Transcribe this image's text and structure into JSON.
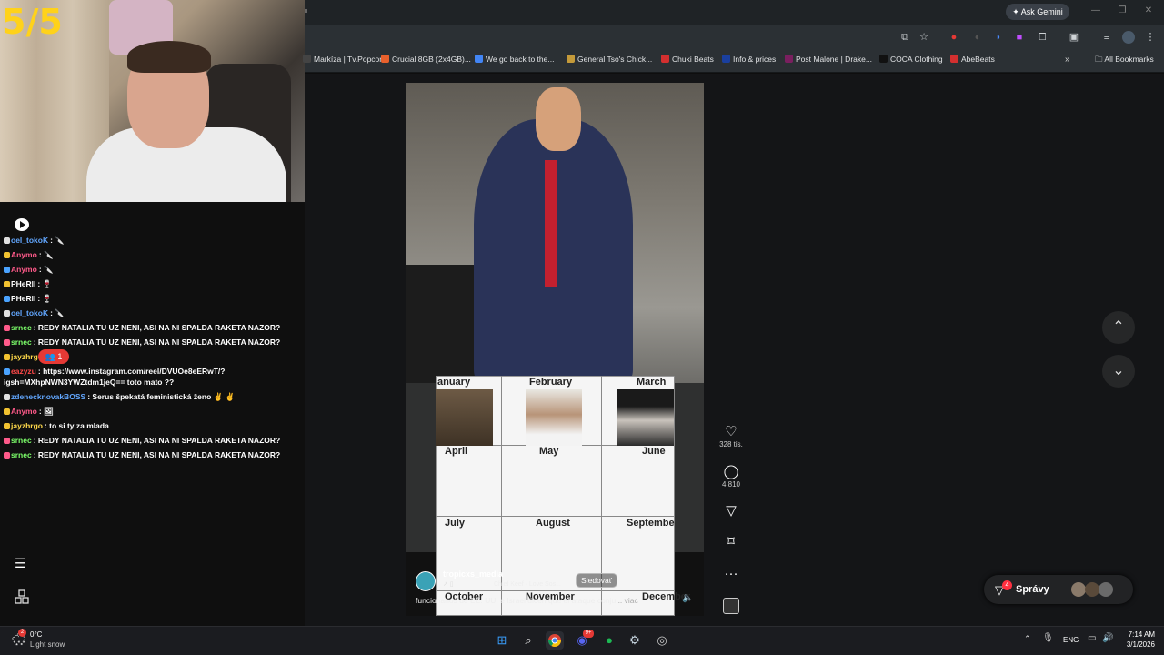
{
  "stream": {
    "score": "5/5",
    "chat": [
      {
        "user": "oel_tokoK",
        "user_color": "#62a7ff",
        "msg": ": 🔪"
      },
      {
        "user": "Anymo",
        "user_color": "#ff5a8a",
        "msg": ": 🔪"
      },
      {
        "user": "Anymo",
        "user_color": "#ff5a8a",
        "msg": ": 🔪"
      },
      {
        "user": "PHeRll",
        "user_color": "#ffffff",
        "msg": ": 🍷"
      },
      {
        "user": "PHeRll",
        "user_color": "#ffffff",
        "msg": ": 🍷"
      },
      {
        "user": "oel_tokoK",
        "user_color": "#62a7ff",
        "msg": ": 🔪"
      },
      {
        "user": "srnec",
        "user_color": "#7cff6a",
        "msg": ": REDY NATALIA TU UZ NENI, ASI NA NI SPALDA RAKETA NAZOR?"
      },
      {
        "user": "srnec",
        "user_color": "#7cff6a",
        "msg": ": REDY NATALIA TU UZ NENI, ASI NA NI SPALDA RAKETA NAZOR?"
      },
      {
        "user": "jayzhrgo",
        "user_color": "#ffd94a",
        "msg": ":"
      },
      {
        "user": "eazyzu",
        "user_color": "#ff4848",
        "msg": ": https://www.instagram.com/reel/DVUOe8eERwT/?"
      },
      {
        "user": "",
        "user_color": "#ffffff",
        "msg": "igsh=MXhpNWN3YWZtdm1jeQ== toto mato ??"
      },
      {
        "user": "zdenecknovakBOSS",
        "user_color": "#62a7ff",
        "msg": ": Serus špekatá feministická ženo ✌ ✌"
      },
      {
        "user": "Anymo",
        "user_color": "#ff5a8a",
        "msg": ": 🖼"
      },
      {
        "user": "jayzhrgo",
        "user_color": "#ffd94a",
        "msg": ": to si ty za mlada"
      },
      {
        "user": "srnec",
        "user_color": "#7cff6a",
        "msg": ": REDY NATALIA TU UZ NENI, ASI NA NI SPALDA RAKETA NAZOR?"
      },
      {
        "user": "srnec",
        "user_color": "#7cff6a",
        "msg": ": REDY NATALIA TU UZ NENI, ASI NA NI SPALDA RAKETA NAZOR?"
      }
    ],
    "viewer_badge": "1"
  },
  "browser": {
    "ask_gemini": "Ask Gemini",
    "bookmarks": [
      {
        "label": "Markíza | Tv.Popcor...",
        "color": "#444"
      },
      {
        "label": "Crucial 8GB (2x4GB)...",
        "color": "#e8602c"
      },
      {
        "label": "We go back to the...",
        "color": "#4285f4"
      },
      {
        "label": "General Tso's Chick...",
        "color": "#c49a3a"
      },
      {
        "label": "Chuki Beats",
        "color": "#d32f2f"
      },
      {
        "label": "Info & prices",
        "color": "#1a3f9e"
      },
      {
        "label": "Post Malone | Drake...",
        "color": "#7a1f5f"
      },
      {
        "label": "COCA Clothing",
        "color": "#111"
      },
      {
        "label": "AbeBeats",
        "color": "#d32f2f"
      }
    ],
    "all_bookmarks": "All Bookmarks"
  },
  "reel": {
    "months": [
      "anuary",
      "February",
      "March",
      "April",
      "May",
      "June",
      "July",
      "August",
      "Septembe",
      "October",
      "November",
      "December"
    ],
    "likes": "328 tis.",
    "comments": "4 810",
    "author": "tropicxs_media",
    "audio": "Chief Keef · Love Sos...",
    "follow": "Sledovať",
    "caption": "funcionarios de EE. UU. e Israel dicen que el ataque conju",
    "caption_more": "... viac"
  },
  "messages": {
    "label": "Správy",
    "badge": "4"
  },
  "taskbar": {
    "weather_temp": "0°C",
    "weather_desc": "Light snow",
    "weather_badge": "2",
    "lang": "ENG",
    "time": "7:14 AM",
    "date": "3/1/2026",
    "discord_badge": "9+"
  }
}
